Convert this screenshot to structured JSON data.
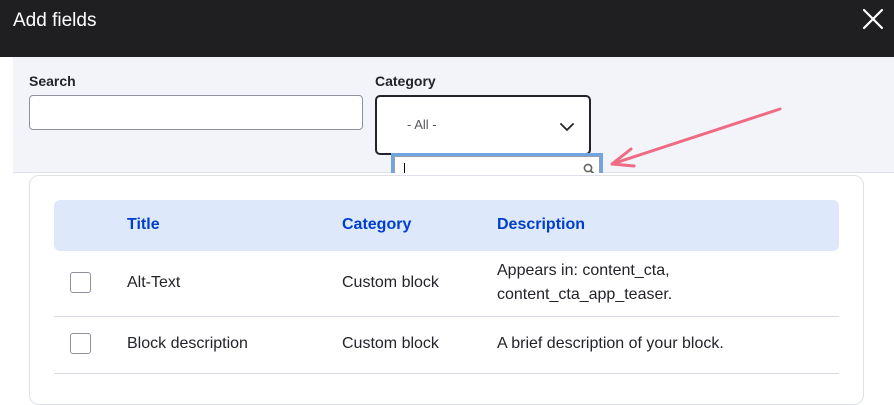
{
  "dialog": {
    "title": "Add fields",
    "close_icon": "close-icon"
  },
  "filters": {
    "search_label": "Search",
    "search_value": "",
    "category_label": "Category",
    "category_selected": "- All -",
    "chevron_icon": "chevron-down-icon",
    "dropdown_search_value": "",
    "dropdown_search_icon": "search-icon"
  },
  "annotation": {
    "color": "#ef6b84"
  },
  "table": {
    "columns": [
      "Title",
      "Category",
      "Description"
    ],
    "rows": [
      {
        "title": "Alt-Text",
        "category": "Custom block",
        "description_line1": "Appears in: content_cta,",
        "description_line2": "content_cta_app_teaser.",
        "checked": false
      },
      {
        "title": "Block description",
        "category": "Custom block",
        "description_line1": "A brief description of your block.",
        "description_line2": "",
        "checked": false
      }
    ]
  },
  "colors": {
    "titlebar": "#1f1f21",
    "panel": "#f3f4f9",
    "header_bg": "#dde8fb",
    "header_text": "#003ecc",
    "focus_ring": "#6fa6e2"
  }
}
